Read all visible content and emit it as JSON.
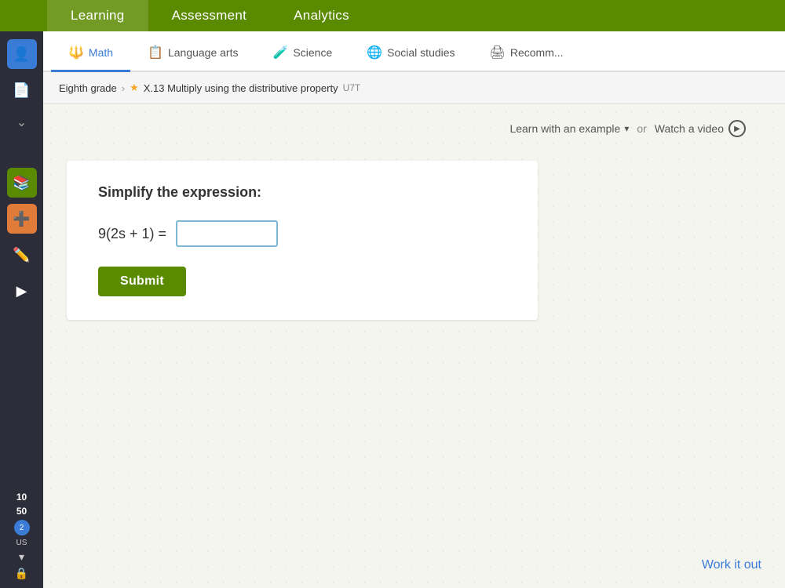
{
  "top_nav": {
    "items": [
      {
        "label": "Learning",
        "active": true
      },
      {
        "label": "Assessment",
        "active": false
      },
      {
        "label": "Analytics",
        "active": false
      }
    ]
  },
  "subject_tabs": {
    "items": [
      {
        "label": "Math",
        "icon": "🔱",
        "active": true
      },
      {
        "label": "Language arts",
        "icon": "📋",
        "active": false
      },
      {
        "label": "Science",
        "icon": "🧪",
        "active": false
      },
      {
        "label": "Social studies",
        "icon": "🌐",
        "active": false
      },
      {
        "label": "Recomm...",
        "icon": "🖨",
        "active": false
      }
    ]
  },
  "breadcrumb": {
    "grade": "Eighth grade",
    "separator": ">",
    "lesson_title": "X.13 Multiply using the distributive property",
    "lesson_code": "U7T"
  },
  "helpers": {
    "learn_example": "Learn with an example",
    "or": "or",
    "watch_video": "Watch a video"
  },
  "problem": {
    "instruction": "Simplify the expression:",
    "equation_left": "9(2s + 1) =",
    "input_placeholder": "",
    "submit_label": "Submit"
  },
  "work_it_out": {
    "label": "Work it out"
  },
  "sidebar": {
    "bottom_items": [
      {
        "label": "10",
        "type": "num"
      },
      {
        "label": "50",
        "type": "num"
      },
      {
        "label": "2",
        "type": "circle"
      },
      {
        "label": "US",
        "type": "text"
      }
    ]
  },
  "colors": {
    "green": "#5a8a00",
    "blue": "#3a7bd5",
    "tab_active": "#3a7bd5"
  }
}
